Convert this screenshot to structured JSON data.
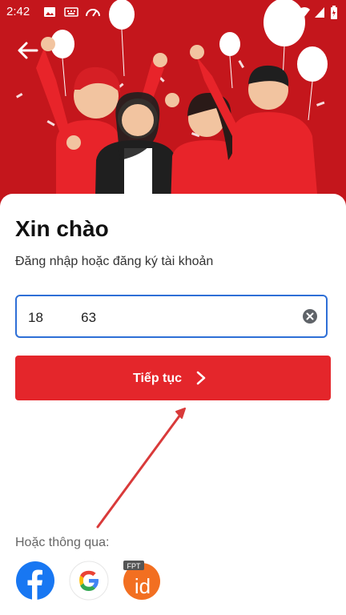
{
  "status_bar": {
    "time": "2:42"
  },
  "greeting": {
    "title": "Xin chào",
    "subtitle": "Đăng nhập hoặc đăng ký tài khoản"
  },
  "phone_field": {
    "value": "18          63",
    "placeholder": ""
  },
  "continue_button": {
    "label": "Tiếp tục"
  },
  "social_login": {
    "label": "Hoặc thông qua:",
    "providers": [
      {
        "name": "Facebook",
        "icon": "facebook-icon"
      },
      {
        "name": "Google",
        "icon": "google-icon"
      },
      {
        "name": "FPT iD",
        "icon": "fpt-id-icon",
        "badge": "FPT",
        "mark": "id"
      }
    ]
  },
  "colors": {
    "primary": "#e4262b",
    "hero_bg": "#c4161c",
    "focus": "#2e6fd6"
  }
}
